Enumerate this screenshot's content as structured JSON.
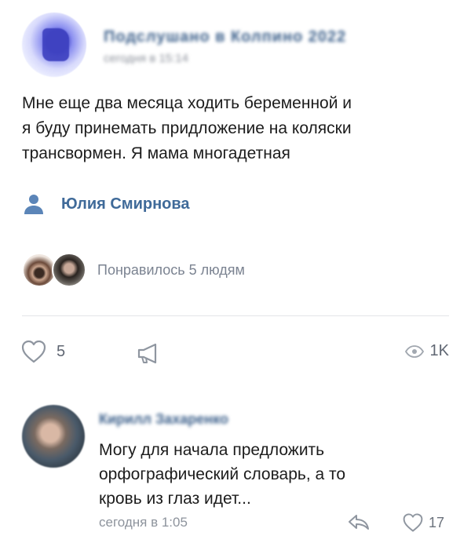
{
  "post": {
    "community_name": "Подслушано в Колпино 2022",
    "time": "сегодня в 15:14",
    "text_lines": [
      "Мне еще два месяца ходить беременной и",
      "я буду принемать придложение на коляски",
      "трансвормен. Я мама многадетная"
    ],
    "signer_name": "Юлия Смирнова",
    "likes_summary": "Понравилось 5 людям",
    "like_count": "5",
    "views": "1K"
  },
  "comment": {
    "author_name": "Кирилл Захаренко",
    "text_lines": [
      "Могу для начала предложить",
      "орфографический словарь, а то",
      "кровь из глаз идет..."
    ],
    "time": "сегодня в 1:05",
    "like_count": "17"
  },
  "colors": {
    "link": "#3f6a99",
    "secondary_text": "#7b8391",
    "icon": "#8f96a0"
  },
  "icons": {
    "signer": "person-icon",
    "like": "heart-icon",
    "share": "megaphone-icon",
    "views": "eye-icon",
    "reply": "reply-icon"
  }
}
